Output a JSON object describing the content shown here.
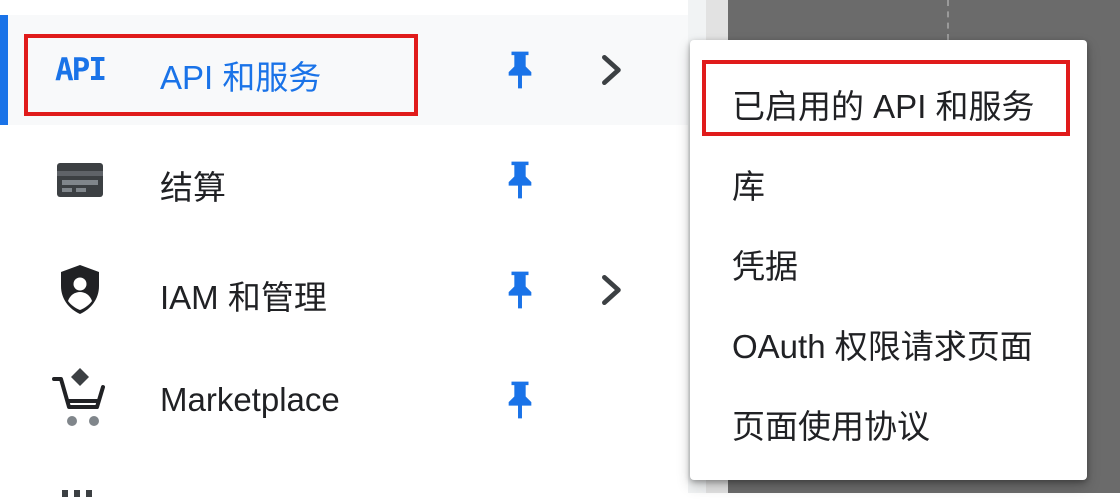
{
  "nav": {
    "items": [
      {
        "label": "API 和服务",
        "icon": "api-icon",
        "active": true,
        "pinned": true,
        "has_submenu": true,
        "api_logo": "API"
      },
      {
        "label": "结算",
        "icon": "billing-card-icon",
        "active": false,
        "pinned": true,
        "has_submenu": false
      },
      {
        "label": "IAM 和管理",
        "icon": "shield-user-icon",
        "active": false,
        "pinned": true,
        "has_submenu": true
      },
      {
        "label": "Marketplace",
        "icon": "marketplace-cart-icon",
        "active": false,
        "pinned": true,
        "has_submenu": false
      }
    ]
  },
  "submenu": {
    "items": [
      {
        "label": "已启用的 API 和服务"
      },
      {
        "label": "库"
      },
      {
        "label": "凭据"
      },
      {
        "label": "OAuth 权限请求页面"
      },
      {
        "label": "页面使用协议"
      }
    ]
  },
  "colors": {
    "accent": "#1a73e8",
    "highlight_box": "#e01b1b",
    "text": "#202124",
    "icon_dark": "#3c4043"
  }
}
